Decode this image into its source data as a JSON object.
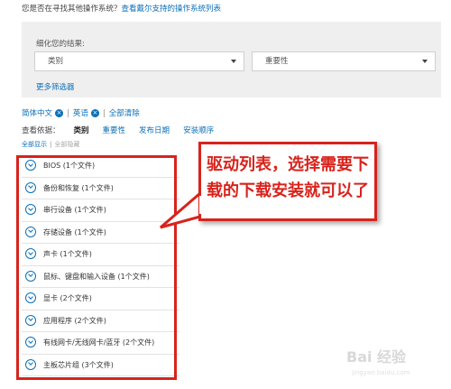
{
  "top": {
    "question": "您是否在寻找其他操作系统？",
    "link": "查看戴尔支持的操作系统列表"
  },
  "filter_panel": {
    "label": "细化您的结果:",
    "category_select": "类别",
    "importance_select": "重要性",
    "more_filters": "更多筛选器"
  },
  "chips": {
    "items": [
      "简体中文",
      "英语"
    ],
    "clear_all": "全部清除"
  },
  "sort": {
    "label": "查看依据：",
    "options": [
      "类别",
      "重要性",
      "发布日期",
      "安装顺序"
    ],
    "active_index": 0
  },
  "expand": {
    "show_all": "全部显示",
    "hide_all": "全部隐藏"
  },
  "categories": [
    "BIOS (1个文件)",
    "备份和恢复 (1个文件)",
    "串行设备 (1个文件)",
    "存储设备 (1个文件)",
    "声卡 (1个文件)",
    "鼠标、键盘和输入设备 (1个文件)",
    "显卡 (2个文件)",
    "应用程序 (2个文件)",
    "有线网卡/无线网卡/蓝牙 (2个文件)",
    "主板芯片组 (3个文件)"
  ],
  "callout": {
    "text": "驱动列表，选择需要下\n载的下载安装就可以了"
  },
  "watermark": {
    "logo": "Bai 经验",
    "sub": "jingyan.baidu.com"
  },
  "colors": {
    "link": "#0b6fb8",
    "annotation_red": "#d8231c",
    "panel_bg": "#efefef"
  }
}
